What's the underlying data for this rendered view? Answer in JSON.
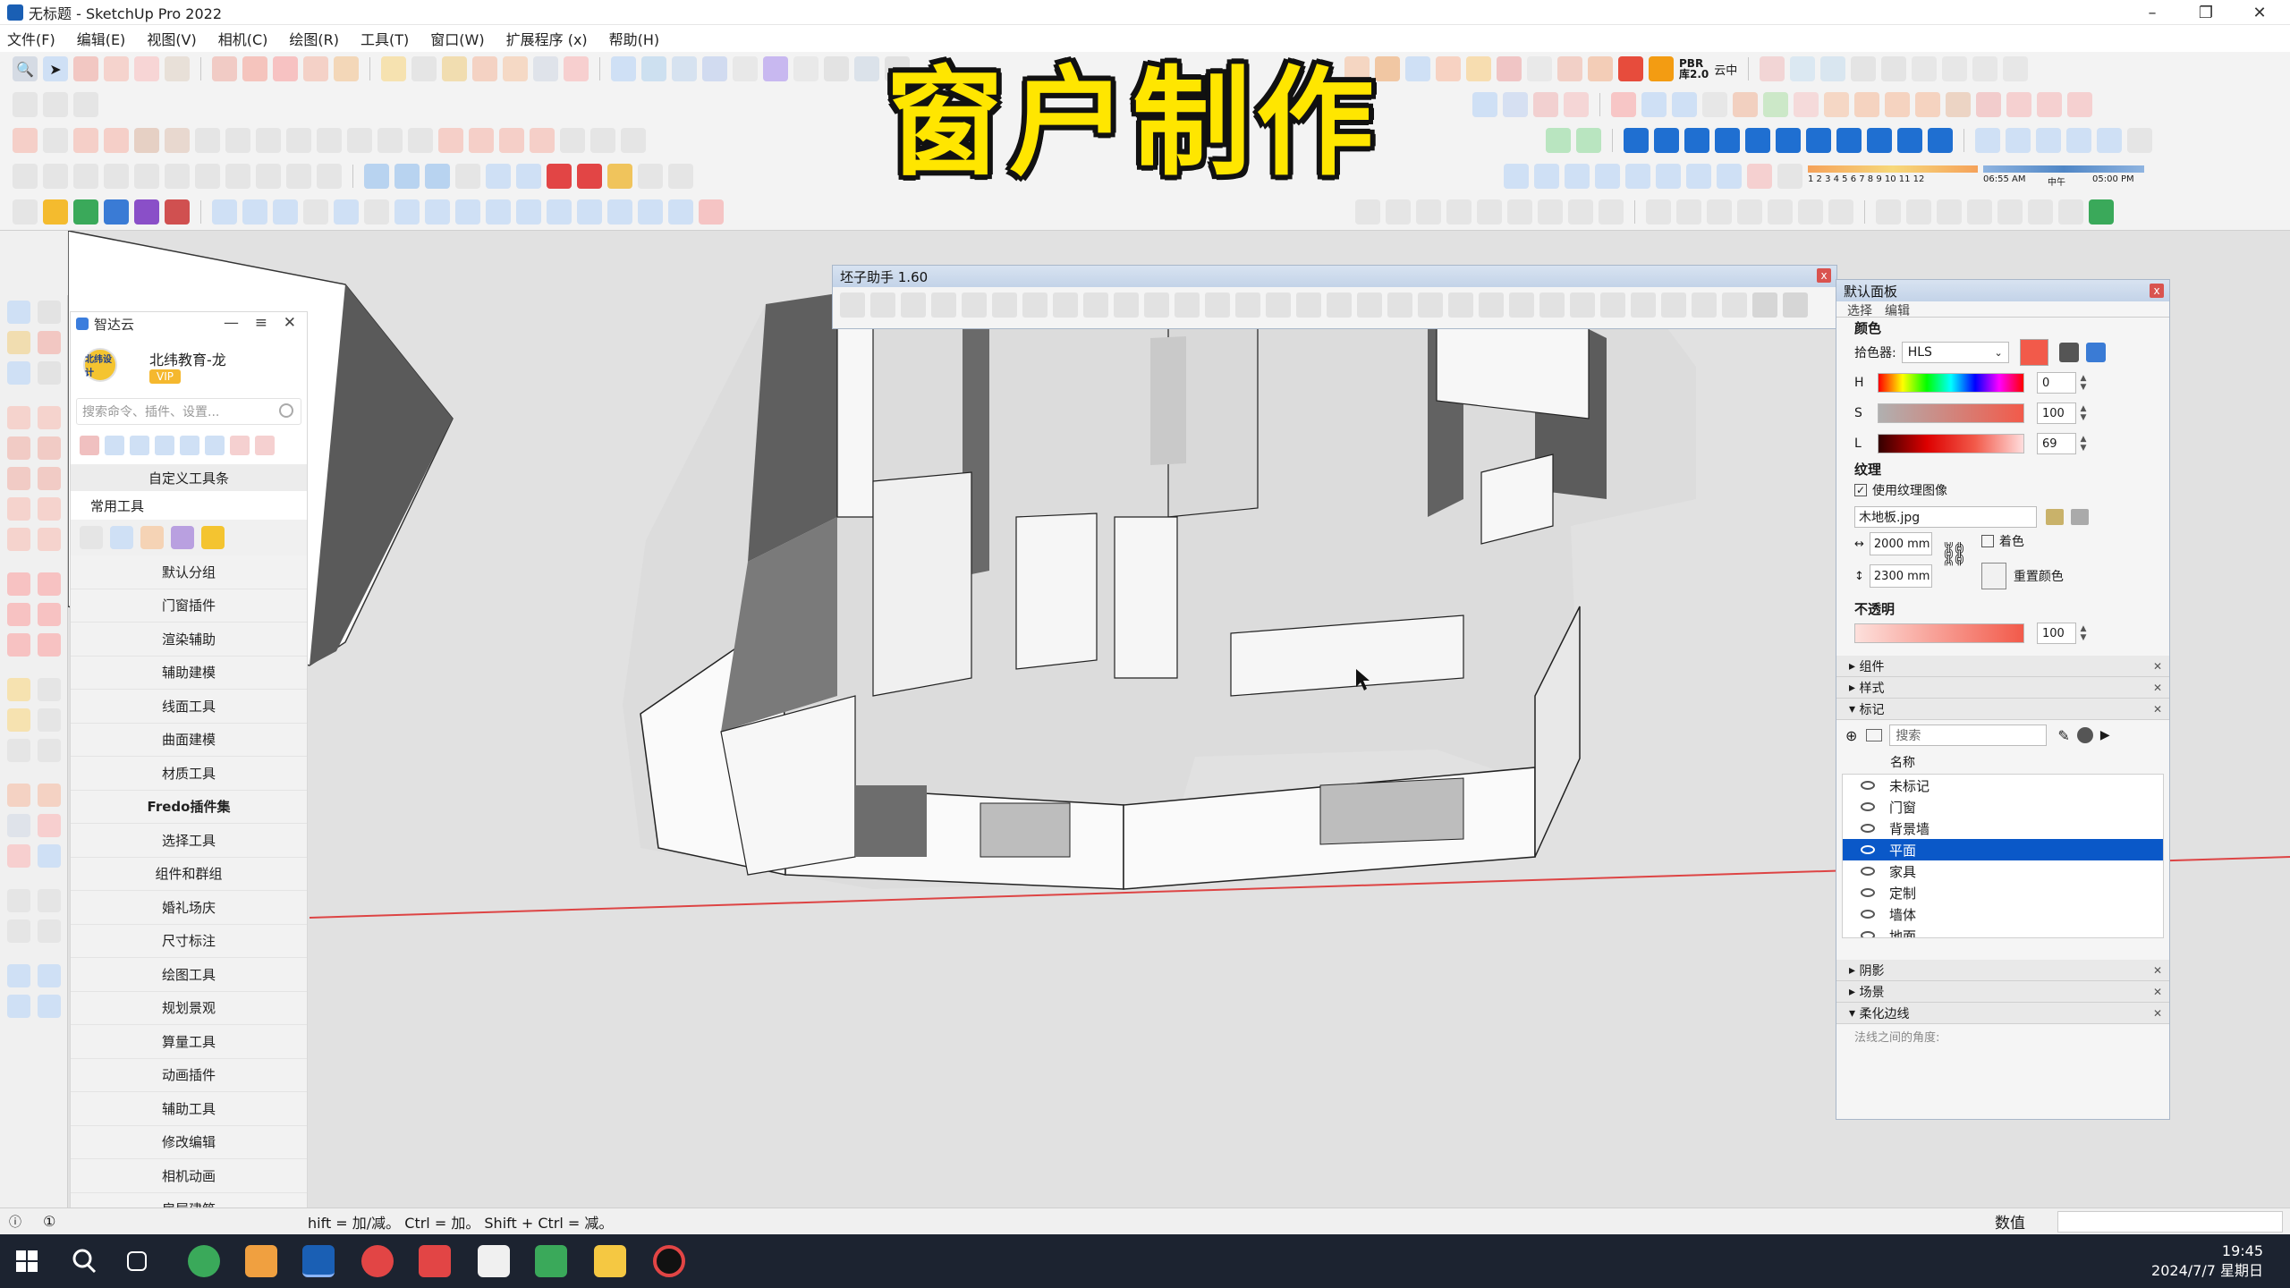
{
  "window": {
    "title": "无标题 - SketchUp Pro 2022",
    "minimize": "–",
    "maximize": "❐",
    "close": "✕"
  },
  "menu": [
    "文件(F)",
    "编辑(E)",
    "视图(V)",
    "相机(C)",
    "绘图(R)",
    "工具(T)",
    "窗口(W)",
    "扩展程序 (x)",
    "帮助(H)"
  ],
  "overlay_title": "窗户制作",
  "toolbar_labels": {
    "pbr": "PBR",
    "ku": "库2.0",
    "yunzhong": "云中",
    "shadow_hours": "1 2 3 4 5 6 7 8 9 10 11 12",
    "time_am": "06:55 AM",
    "noon": "中午",
    "time_pm": "05:00 PM"
  },
  "zhidayun": {
    "title": "智达云",
    "logo_text": "北纬设计",
    "user": "北纬教育-龙",
    "vip": "VIP",
    "search_placeholder": "搜索命令、插件、设置...",
    "custom_toolbar": "自定义工具条",
    "common_tools": "常用工具",
    "categories": [
      "默认分组",
      "门窗插件",
      "渲染辅助",
      "辅助建模",
      "线面工具",
      "曲面建模",
      "材质工具",
      "Fredo插件集",
      "选择工具",
      "组件和群组",
      "婚礼场庆",
      "尺寸标注",
      "绘图工具",
      "规划景观",
      "算量工具",
      "动画插件",
      "辅助工具",
      "修改编辑",
      "相机动画",
      "房屋建筑"
    ]
  },
  "peizi": {
    "title": "坯子助手 1.60",
    "close": "x"
  },
  "tray": {
    "title": "默认面板",
    "close": "x",
    "tabs": [
      "选择",
      "编辑"
    ],
    "color_head": "颜色",
    "picker_label": "拾色器:",
    "picker_value": "HLS",
    "swatch_color": "#f25a4a",
    "h_label": "H",
    "h_value": "0",
    "s_label": "S",
    "s_value": "100",
    "l_label": "L",
    "l_value": "69",
    "texture_head": "纹理",
    "use_texture": "使用纹理图像",
    "texture_file": "木地板.jpg",
    "width_mm": "2000 mm",
    "height_mm": "2300 mm",
    "colorize": "着色",
    "reset_color": "重置颜色",
    "opacity_head": "不透明",
    "opacity_value": "100",
    "sections_top": [
      "组件",
      "样式",
      "标记"
    ],
    "tag_search": "搜索",
    "tag_col": "名称",
    "tags": [
      "未标记",
      "门窗",
      "背景墙",
      "平面",
      "家具",
      "定制",
      "墙体",
      "地面"
    ],
    "selected_tag": "平面",
    "sections_bottom": [
      "阴影",
      "场景",
      "柔化边线"
    ],
    "soften_hint": "法线之间的角度:"
  },
  "status": {
    "hint": "hift = 加/减。 Ctrl = 加。 Shift + Ctrl = 减。",
    "measure_label": "数值"
  },
  "taskbar": {
    "time": "19:45",
    "date": "2024/7/7 星期日"
  }
}
